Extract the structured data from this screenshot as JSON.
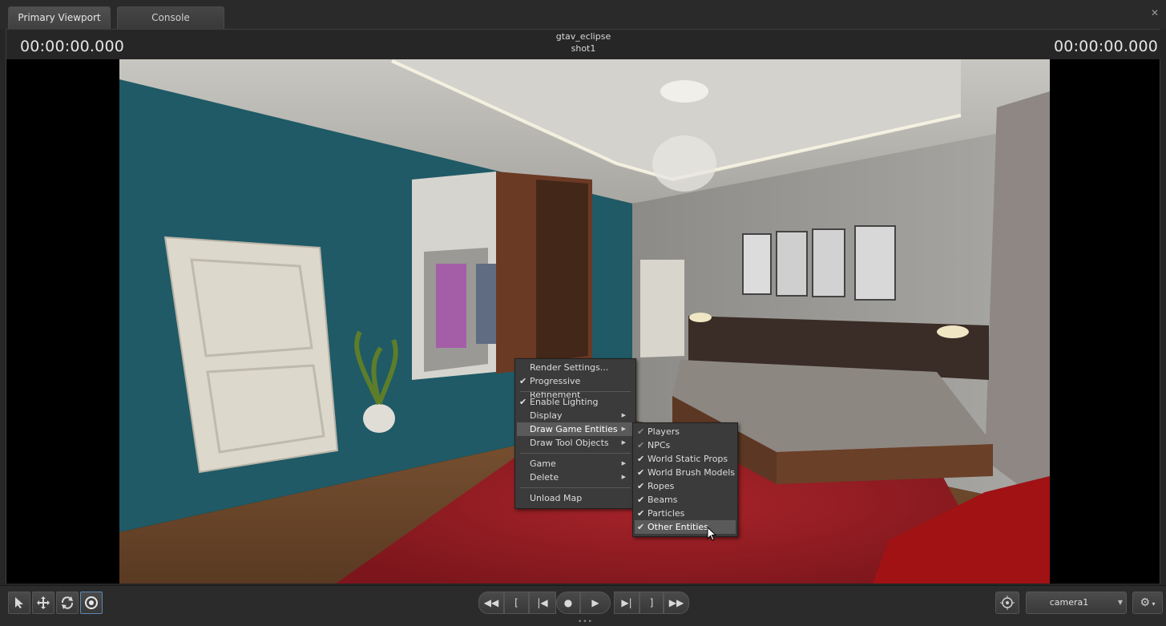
{
  "tabs": [
    {
      "label": "Primary Viewport",
      "active": true
    },
    {
      "label": "Console",
      "active": false
    }
  ],
  "header": {
    "timecode_left": "00:00:00.000",
    "timecode_right": "00:00:00.000",
    "project": "gtav_eclipse",
    "shot": "shot1"
  },
  "context_menu": {
    "items": [
      {
        "label": "Render Settings...",
        "checked": false,
        "submenu": false
      },
      {
        "label": "Progressive Refinement",
        "checked": true,
        "submenu": false
      },
      {
        "label": "Enable Lighting",
        "checked": true,
        "submenu": false
      },
      {
        "label": "Display",
        "checked": false,
        "submenu": true
      },
      {
        "label": "Draw Game Entities",
        "checked": false,
        "submenu": true,
        "highlighted": true
      },
      {
        "label": "Draw Tool Objects",
        "checked": false,
        "submenu": true
      },
      {
        "label": "Game",
        "checked": false,
        "submenu": true
      },
      {
        "label": "Delete",
        "checked": false,
        "submenu": true
      },
      {
        "label": "Unload Map",
        "checked": false,
        "submenu": false
      }
    ]
  },
  "submenu": {
    "items": [
      {
        "label": "Players",
        "checked": true,
        "dim": true
      },
      {
        "label": "NPCs",
        "checked": true,
        "dim": true
      },
      {
        "label": "World Static Props",
        "checked": true
      },
      {
        "label": "World Brush Models",
        "checked": true
      },
      {
        "label": "Ropes",
        "checked": true
      },
      {
        "label": "Beams",
        "checked": true
      },
      {
        "label": "Particles",
        "checked": true
      },
      {
        "label": "Other Entities",
        "checked": true,
        "highlighted": true
      }
    ]
  },
  "toolbar": {
    "camera": "camera1",
    "icons": [
      "select-arrow-icon",
      "move-icon",
      "rotate-icon",
      "target-icon"
    ]
  },
  "playback": {
    "icons": [
      "rewind-icon",
      "mark-in-icon",
      "step-back-icon",
      "record-icon",
      "play-icon",
      "step-forward-icon",
      "mark-out-icon",
      "fast-forward-icon"
    ]
  },
  "colors": {
    "ui_dark": "#262626",
    "menu_bg": "#3b3b3b",
    "menu_highlight": "#5a5a5a",
    "wall_teal": "#1f5a66"
  }
}
